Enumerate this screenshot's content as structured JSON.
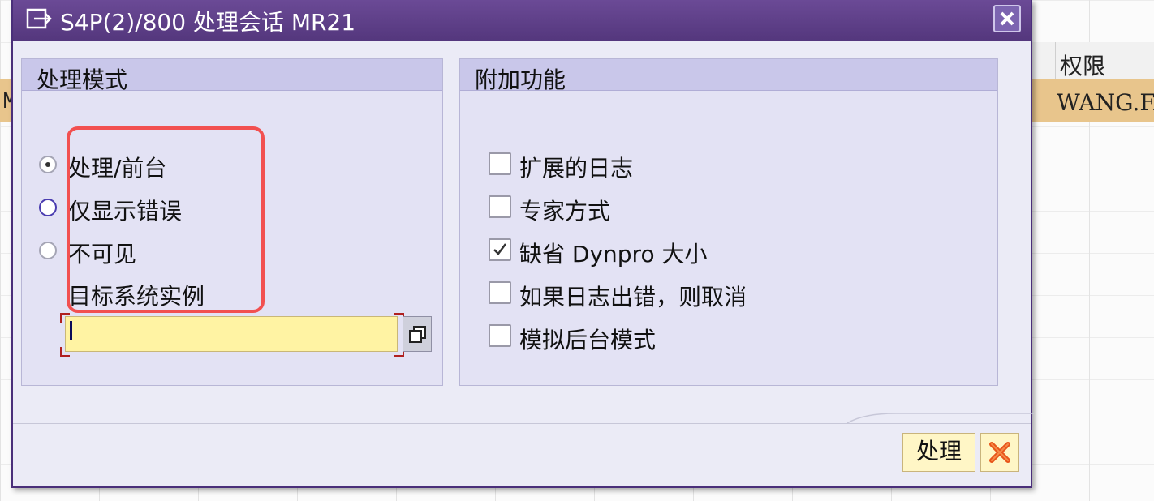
{
  "background": {
    "column_header": "权限",
    "row_left_fragment": "M",
    "row_value": "WANG.FA"
  },
  "dialog": {
    "title": "S4P(2)/800 处理会话 MR21",
    "close_icon": "close-icon"
  },
  "mode_group": {
    "title": "处理模式",
    "options": [
      {
        "label": "处理/前台",
        "selected": true
      },
      {
        "label": "仅显示错误",
        "selected": false
      },
      {
        "label": "不可见",
        "selected": false
      }
    ],
    "target_label": "目标系统实例",
    "target_value": ""
  },
  "extra_group": {
    "title": "附加功能",
    "options": [
      {
        "label": "扩展的日志",
        "checked": false
      },
      {
        "label": "专家方式",
        "checked": false
      },
      {
        "label": "缺省 Dynpro 大小",
        "checked": true
      },
      {
        "label": "如果日志出错，则取消",
        "checked": false
      },
      {
        "label": "模拟后台模式",
        "checked": false
      }
    ]
  },
  "footer": {
    "process_label": "处理",
    "cancel_icon": "cancel-icon"
  },
  "colors": {
    "titlebar": "#5b3f86",
    "group_header": "#c9c7ea",
    "input_bg": "#fff3a3",
    "highlight_box": "#f25050",
    "row_highlight": "#e8c58c"
  }
}
